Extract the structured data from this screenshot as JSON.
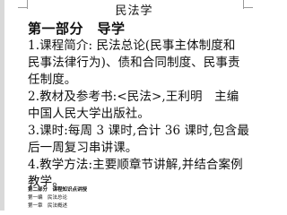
{
  "document": {
    "title": "民法学",
    "part_heading": "第一部分　导学",
    "lines": [
      "1.课程简介: 民法总论(民事主体制度和",
      "民事法律行为)、债和合同制度、民事责",
      "任制度。",
      "2.教材及参考书:<民法>,王利明　主编",
      "中国人民大学出版社。",
      "3.课时:每周 3 课时,合计 36 课时,包含最",
      "后一周复习串讲课。",
      "4.教学方法:主要顺章节讲解,并结合案例"
    ],
    "last_line": "教学。",
    "toc": [
      "第二部分　课程知识点讲授",
      "第一编　民法总论",
      "第一章　民法概述"
    ]
  }
}
